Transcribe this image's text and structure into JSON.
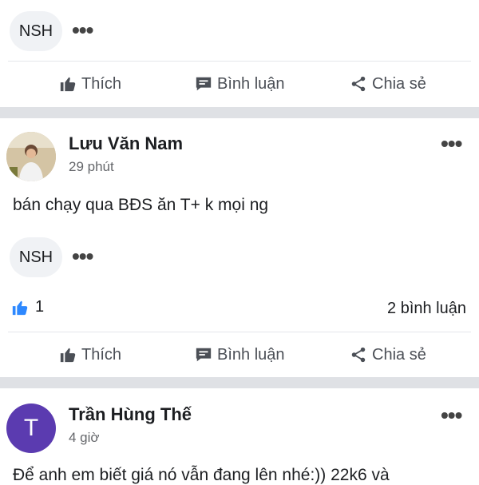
{
  "post_top": {
    "reaction_chip": "NSH",
    "more_icon": "more-dots-icon",
    "actions": {
      "like": "Thích",
      "comment": "Bình luận",
      "share": "Chia sẻ"
    }
  },
  "post_1": {
    "author": "Lưu Văn Nam",
    "time": "29 phút",
    "text": "bán chạy qua BĐS ăn T+ k mọi ng",
    "reaction_chip": "NSH",
    "like_count": "1",
    "comments_count": "2 bình luận",
    "actions": {
      "like": "Thích",
      "comment": "Bình luận",
      "share": "Chia sẻ"
    }
  },
  "post_2": {
    "author": "Trần Hùng Thế",
    "avatar_letter": "T",
    "avatar_color": "#5b3bb0",
    "time": "4 giờ",
    "text": "Để anh em biết giá nó vẫn đang lên nhé:)) 22k6 và"
  },
  "colors": {
    "like_blue": "#2d88ff",
    "separator": "#dfe1e5",
    "muted": "#65676b"
  }
}
